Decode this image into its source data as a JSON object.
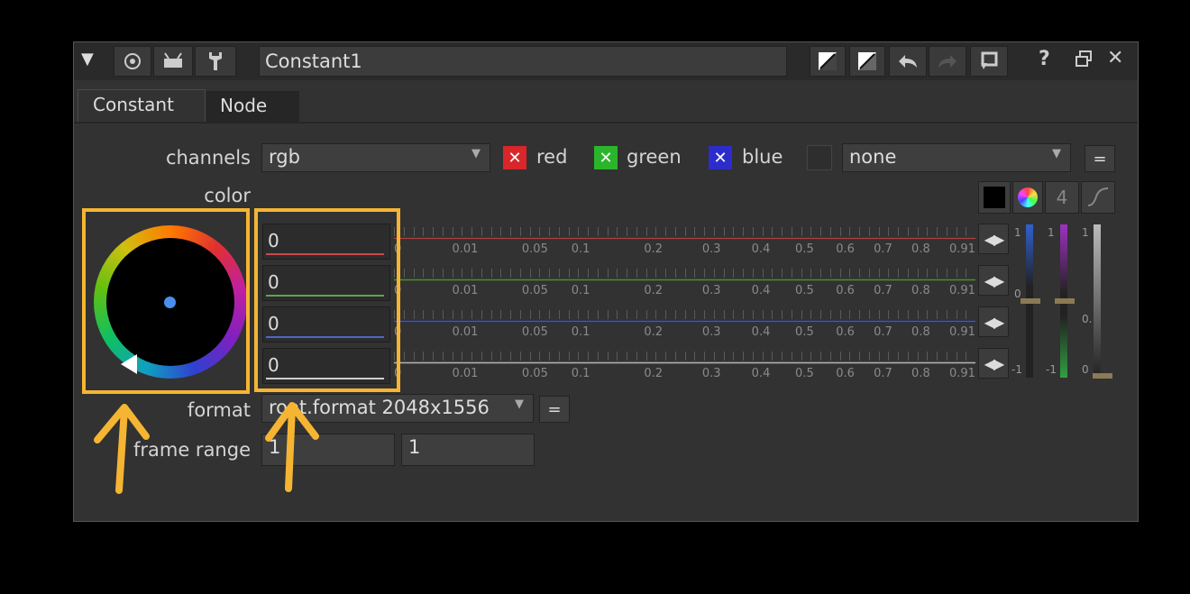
{
  "window": {
    "node_name": "Constant1",
    "icons": [
      "collapse-triangle-icon",
      "circle-target-icon",
      "viewer-icon",
      "wrench-icon",
      "reset-icon",
      "reset-all-icon",
      "undo-icon",
      "redo-icon",
      "revert-icon",
      "help-icon",
      "float-icon",
      "close-icon"
    ]
  },
  "tabs": [
    {
      "label": "Constant",
      "active": true
    },
    {
      "label": "Node",
      "active": false
    }
  ],
  "channels": {
    "label": "channels",
    "value": "rgb",
    "checks": [
      {
        "label": "red",
        "color": "#d8262b"
      },
      {
        "label": "green",
        "color": "#2bb52b"
      },
      {
        "label": "blue",
        "color": "#2c2ccc"
      }
    ],
    "extra_value": "none",
    "link_button": "="
  },
  "color": {
    "label": "color",
    "channel_count": "4",
    "values": [
      {
        "value": "0",
        "accent": "#c84a4a"
      },
      {
        "value": "0",
        "accent": "#5aa84a"
      },
      {
        "value": "0",
        "accent": "#4a6ac8"
      },
      {
        "value": "0",
        "accent": "#d0d0d0"
      }
    ],
    "ticks": [
      "0",
      "0.01",
      "0.05",
      "0.1",
      "0.2",
      "0.3",
      "0.4",
      "0.5",
      "0.6",
      "0.7",
      "0.8",
      "0.91"
    ],
    "side_labels": {
      "top": "1",
      "mid": "0",
      "bottom": "-1",
      "mid2": "0."
    }
  },
  "format": {
    "label": "format",
    "value": "root.format 2048x1556",
    "link_button": "="
  },
  "frame_range": {
    "label": "frame range",
    "start": "1",
    "end": "1"
  },
  "annotations": {
    "highlight_color": "#f5b532"
  }
}
